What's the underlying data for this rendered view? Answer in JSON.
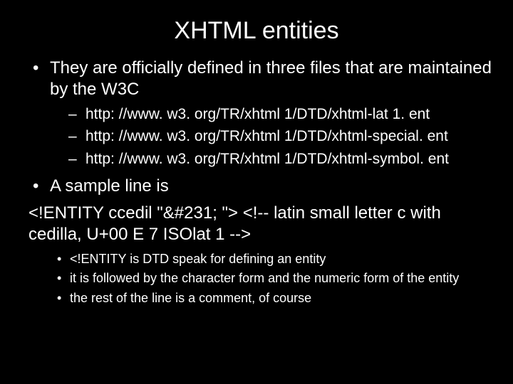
{
  "title": "XHTML entities",
  "bullets": {
    "b1": "They are officially defined in three files that are maintained by the W3C",
    "urls": {
      "u1": "http: //www. w3. org/TR/xhtml 1/DTD/xhtml-lat 1. ent",
      "u2": "http: //www. w3. org/TR/xhtml 1/DTD/xhtml-special. ent",
      "u3": "http: //www. w3. org/TR/xhtml 1/DTD/xhtml-symbol. ent"
    },
    "b2": "A sample line is",
    "b2_code": "<!ENTITY ccedil \"&#231; \"> <!-- latin small letter c with cedilla, U+00 E 7 ISOlat 1 -->",
    "sub": {
      "s1": "<!ENTITY is DTD speak for defining an entity",
      "s2": "it is followed by the character form and the numeric form of the entity",
      "s3": "the rest of the line is a comment, of course"
    }
  }
}
